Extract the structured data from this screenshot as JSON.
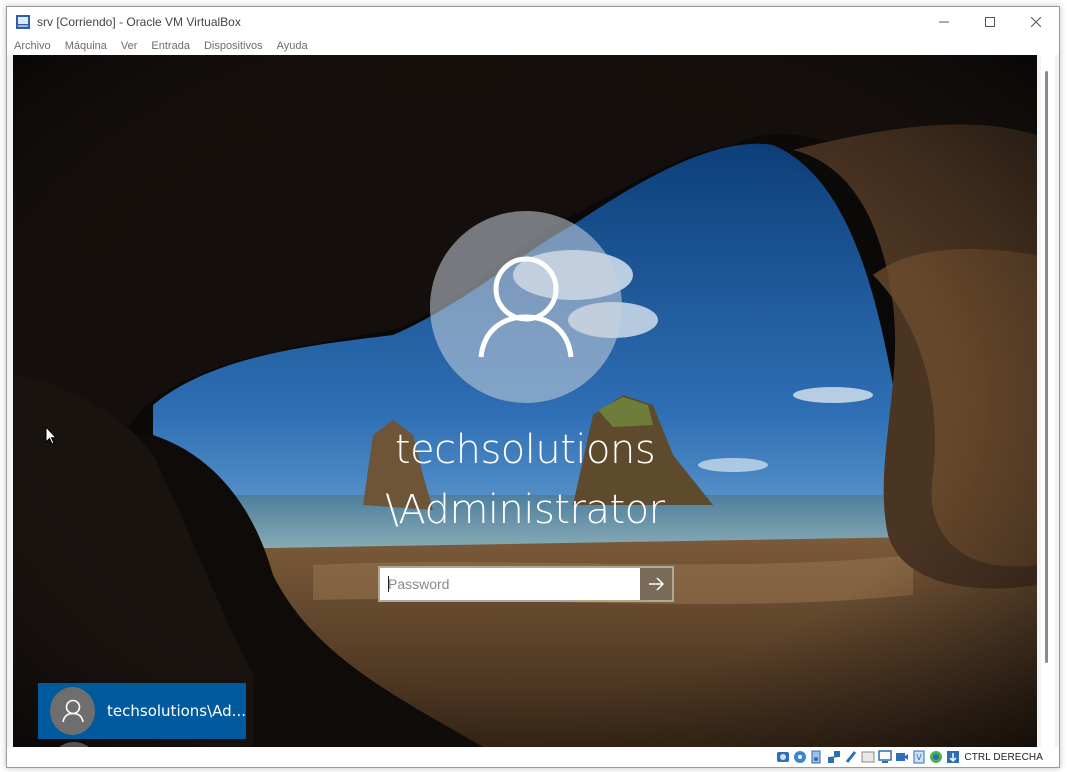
{
  "window": {
    "title": "srv [Corriendo] - Oracle VM VirtualBox"
  },
  "menu": {
    "items": [
      "Archivo",
      "Máquina",
      "Ver",
      "Entrada",
      "Dispositivos",
      "Ayuda"
    ]
  },
  "lockscreen": {
    "user_line1": "techsolutions",
    "user_line2": "\\Administrator",
    "password_placeholder": "Password",
    "tile_label": "techsolutions\\Ad..."
  },
  "statusbar": {
    "host_key": "CTRL DERECHA",
    "icons": [
      "hard-disk-icon",
      "optical-drive-icon",
      "audio-icon",
      "network-icon",
      "usb-icon",
      "shared-folders-icon",
      "display-icon",
      "video-capture-icon",
      "screen-icon",
      "virtualization-icon",
      "mouse-integration-icon",
      "keyboard-icon"
    ]
  },
  "colors": {
    "accent_tile": "#005a9e",
    "submit_button": "#7a6b58"
  }
}
